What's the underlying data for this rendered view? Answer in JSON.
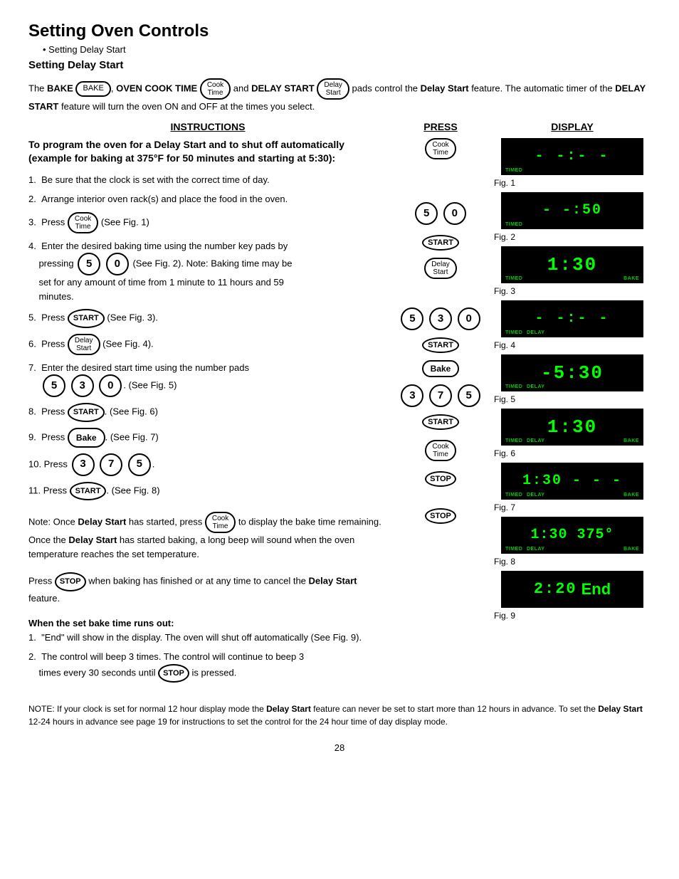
{
  "page": {
    "title": "Setting Oven Controls",
    "breadcrumb": "Setting Delay Start",
    "section_title": "Setting Delay Start",
    "intro": "The BAKE (BAKE), OVEN COOK TIME (Cook Time) and DELAY START (Delay Start) pads control the Delay Start feature. The automatic timer of the DELAY START feature will turn the oven ON and OFF at the times you select.",
    "col_instructions": "INSTRUCTIONS",
    "col_press": "PRESS",
    "col_display": "DISPLAY",
    "main_instruction": "To program the oven for a Delay Start and to shut off automatically (example for baking at 375°F for 50 minutes and starting at 5:30):",
    "steps": [
      "Be sure that the clock is set with the correct time of day.",
      "Arrange interior oven rack(s) and place the food in the oven.",
      "Press (Cook Time) (See Fig. 1)",
      "Enter the desired baking time using the number key pads by pressing 5 0 (See Fig. 2). Note: Baking time may be set for any amount of time from 1 minute to 11 hours and 59 minutes.",
      "Press (START) (See Fig. 3).",
      "Press (Delay Start) (See Fig. 4).",
      "Enter the desired start time using the number pads 5 3 0. (See Fig. 5)",
      "Press (START). (See Fig. 6)",
      "Press (Bake). (See Fig. 7)",
      "Press 3 7 5.",
      "Press (START). (See Fig. 8)"
    ],
    "note_delay_start": "Note: Once Delay Start has started, press (Cook Time) to display the bake time remaining. Once the Delay Start has started baking, a long beep will sound when the oven temperature reaches the set temperature.",
    "stop_note": "Press (STOP) when baking has finished or at any time to cancel the Delay Start feature.",
    "when_bake_runs_out_title": "When the set bake time runs out:",
    "when_bake_step1": "\"End\" will show in the display. The oven will shut off automatically (See Fig. 9).",
    "when_bake_step2": "The control will beep 3 times. The control will continue to beep 3 times every 30 seconds until (STOP) is pressed.",
    "bottom_note": "NOTE: If your clock is set for normal 12 hour display mode the Delay Start feature can never be set to start more than 12 hours in advance. To set the Delay Start 12-24 hours in advance see page 19 for instructions to set the control for the 24 hour time of day display mode.",
    "page_num": "28",
    "figures": [
      {
        "id": "Fig. 1",
        "display": "--:--",
        "labels": [
          "TIMED"
        ]
      },
      {
        "id": "Fig. 2",
        "display": "--:50",
        "labels": [
          "TIMED"
        ]
      },
      {
        "id": "Fig. 3",
        "display": "1:30",
        "labels": [
          "TIMED",
          "BAKE"
        ]
      },
      {
        "id": "Fig. 4",
        "display": "--:--",
        "labels": [
          "TIMED DELAY"
        ]
      },
      {
        "id": "Fig. 5",
        "display": "-5:30",
        "labels": [
          "TIMED DELAY"
        ]
      },
      {
        "id": "Fig. 6",
        "display": "1:30",
        "labels": [
          "TIMED DELAY",
          "BAKE"
        ]
      },
      {
        "id": "Fig. 7",
        "display": "1:30 ---",
        "labels": [
          "TIMED DELAY",
          "BAKE"
        ]
      },
      {
        "id": "Fig. 8",
        "display": "1:30 375°",
        "labels": [
          "TIMED DELAY",
          "BAKE"
        ]
      },
      {
        "id": "Fig. 9",
        "display": "2:20 End",
        "labels": []
      }
    ]
  }
}
